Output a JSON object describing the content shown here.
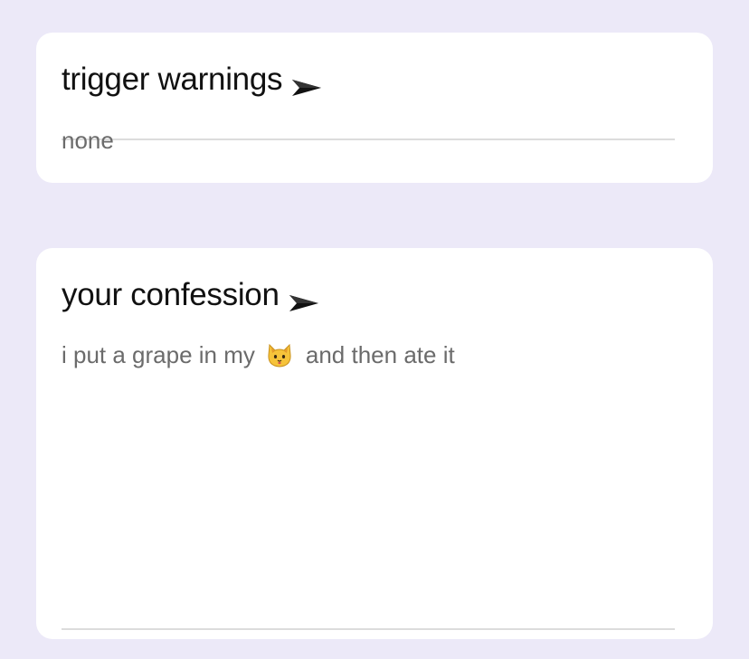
{
  "trigger_warnings": {
    "title": "trigger warnings",
    "icon": "send-arrow-icon",
    "value": "none"
  },
  "confession": {
    "title": "your confession",
    "icon": "send-arrow-icon",
    "text_before": "i put a grape in my",
    "emoji": "cat-face-emoji",
    "text_after": "and then ate it"
  },
  "colors": {
    "background": "#ece9f8",
    "card": "#ffffff",
    "title": "#111111",
    "field_text": "#6b6b6b",
    "field_line": "#dcdcdc",
    "emoji_fill": "#f6c33a"
  }
}
